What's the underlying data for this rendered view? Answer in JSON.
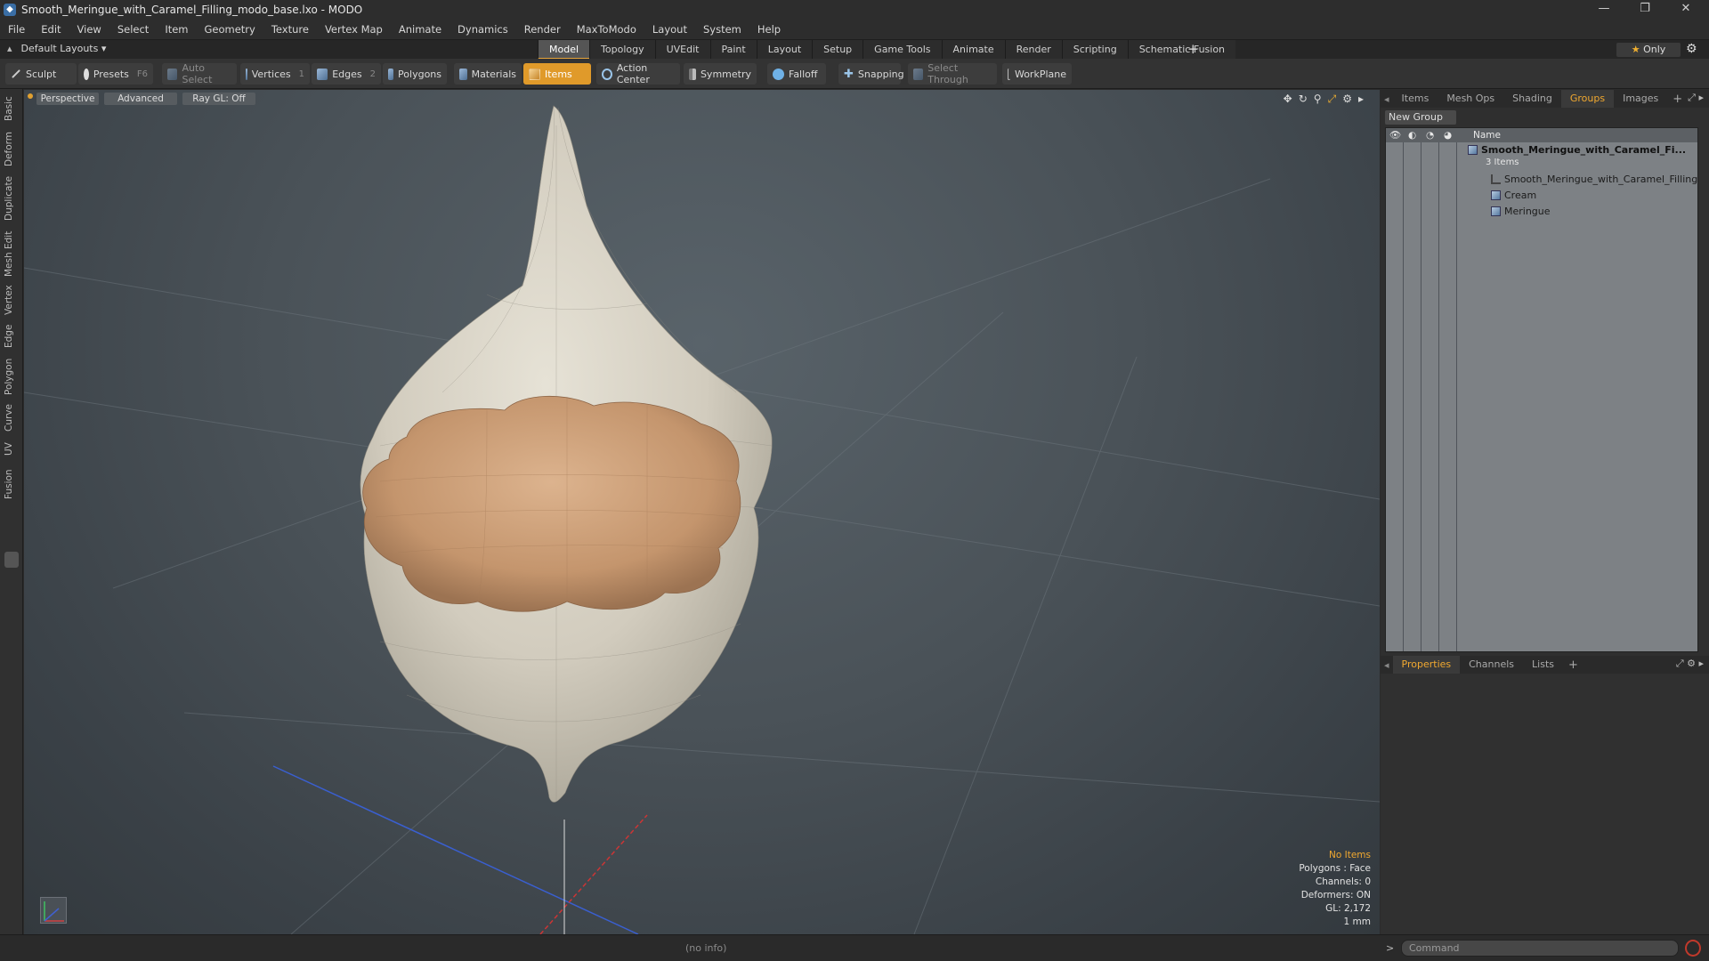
{
  "window": {
    "title": "Smooth_Meringue_with_Caramel_Filling_modo_base.lxo - MODO",
    "controls": [
      "—",
      "❐",
      "✕"
    ]
  },
  "menu": [
    "File",
    "Edit",
    "View",
    "Select",
    "Item",
    "Geometry",
    "Texture",
    "Vertex Map",
    "Animate",
    "Dynamics",
    "Render",
    "MaxToModo",
    "Layout",
    "System",
    "Help"
  ],
  "layouts": {
    "label": "Default Layouts ▾"
  },
  "layout_tabs": [
    "Model",
    "Topology",
    "UVEdit",
    "Paint",
    "Layout",
    "Setup",
    "Game Tools",
    "Animate",
    "Render",
    "Scripting",
    "Schematic Fusion"
  ],
  "active_layout_tab": "Model",
  "only_button": {
    "star": "★",
    "label": "Only"
  },
  "toolbar": {
    "sculpt": "Sculpt",
    "presets": "Presets",
    "presets_key": "F6",
    "auto_select": "Auto Select",
    "vertices": "Vertices",
    "vertices_key": "1",
    "edges": "Edges",
    "edges_key": "2",
    "polygons": "Polygons",
    "materials": "Materials",
    "items": "Items",
    "action_center": "Action Center",
    "symmetry": "Symmetry",
    "falloff": "Falloff",
    "snapping": "Snapping",
    "select_through": "Select Through",
    "workplane": "WorkPlane"
  },
  "left_strip": [
    "Basic",
    "Deform",
    "Duplicate",
    "Mesh Edit",
    "Vertex",
    "Edge",
    "Polygon",
    "Curve",
    "UV",
    "Fusion"
  ],
  "viewport": {
    "view_mode": "Perspective",
    "advanced": "Advanced",
    "raygl": "Ray GL: Off",
    "stats": {
      "items": "No Items",
      "polygons": "Polygons : Face",
      "channels": "Channels: 0",
      "deformers": "Deformers: ON",
      "gl": "GL: 2,172",
      "unit": "1 mm"
    }
  },
  "right_panel": {
    "top_tabs": [
      "Items",
      "Mesh Ops",
      "Shading",
      "Groups",
      "Images"
    ],
    "active_top_tab": "Groups",
    "new_group": "New Group",
    "column_name": "Name",
    "group_root": "Smooth_Meringue_with_Caramel_Fi...",
    "group_count": "3 Items",
    "children": [
      "Smooth_Meringue_with_Caramel_Filling",
      "Cream",
      "Meringue"
    ],
    "bottom_tabs": [
      "Properties",
      "Channels",
      "Lists"
    ],
    "active_bottom_tab": "Properties"
  },
  "status": {
    "info": "(no info)",
    "command_placeholder": "Command"
  },
  "colors": {
    "accent": "#e09a2a",
    "meringue": "#d8d3c6",
    "caramel": "#c99b73"
  }
}
